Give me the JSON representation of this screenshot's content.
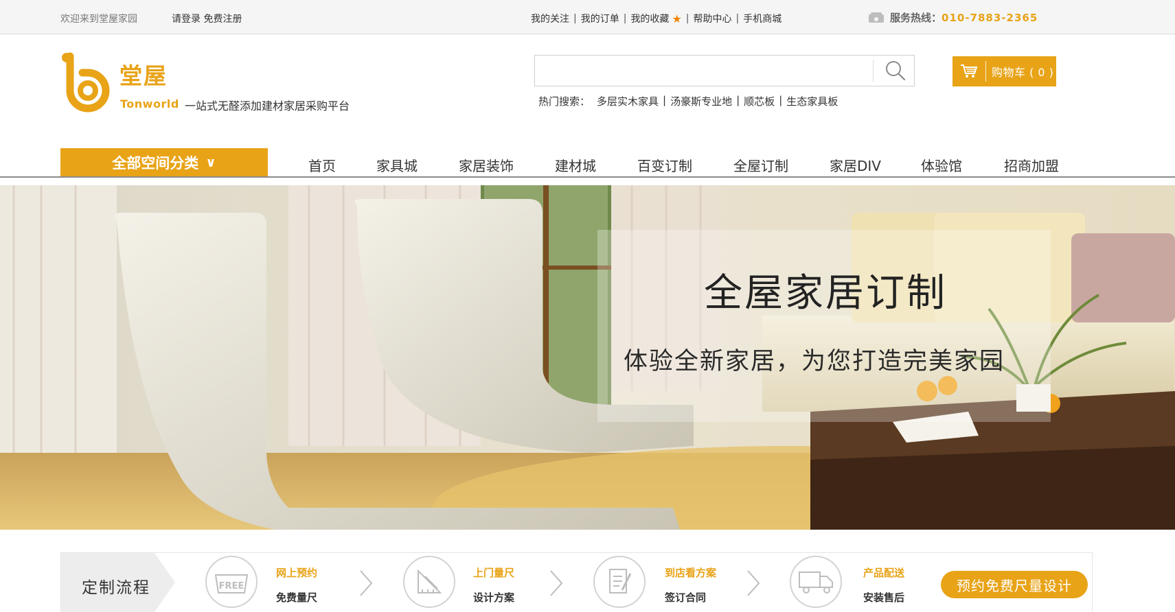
{
  "topbar": {
    "welcome": "欢迎来到堂屋家园",
    "login": "请登录",
    "register": "免费注册",
    "links": [
      "我的关注",
      "我的订单",
      "我的收藏",
      "帮助中心",
      "手机商城"
    ],
    "hotline_label": "服务热线：",
    "hotline_number": "010-7883-2365"
  },
  "header": {
    "brand_cn": "堂屋",
    "brand_en": "Tonworld",
    "slogan": "一站式无醛添加建材家居采购平台",
    "search_placeholder": "",
    "hot_label": "热门搜索：",
    "hot_terms": [
      "多层实木家具",
      "汤豪斯专业地",
      "顺芯板",
      "生态家具板"
    ],
    "cart_label": "购物车 ( 0 )"
  },
  "nav": {
    "category_button": "全部空间分类",
    "category_chevron": "∨",
    "items": [
      "首页",
      "家具城",
      "家居装饰",
      "建材城",
      "百变订制",
      "全屋订制",
      "家居DIV",
      "体验馆",
      "招商加盟"
    ]
  },
  "banner": {
    "headline": "全屋家居订制",
    "subline": "体验全新家居，为您打造完美家园"
  },
  "process": {
    "tag": "定制流程",
    "steps": [
      {
        "title": "网上预约",
        "sub": "免费量尺",
        "icon": "free-icon"
      },
      {
        "title": "上门量尺",
        "sub": "设计方案",
        "icon": "ruler-icon"
      },
      {
        "title": "到店看方案",
        "sub": "签订合同",
        "icon": "document-icon"
      },
      {
        "title": "产品配送",
        "sub": "安装售后",
        "icon": "truck-icon"
      }
    ],
    "cta": "预约免费尺量设计"
  },
  "colors": {
    "accent": "#e8a317",
    "topbar_bg": "#f5f5f5",
    "text": "#333333"
  }
}
